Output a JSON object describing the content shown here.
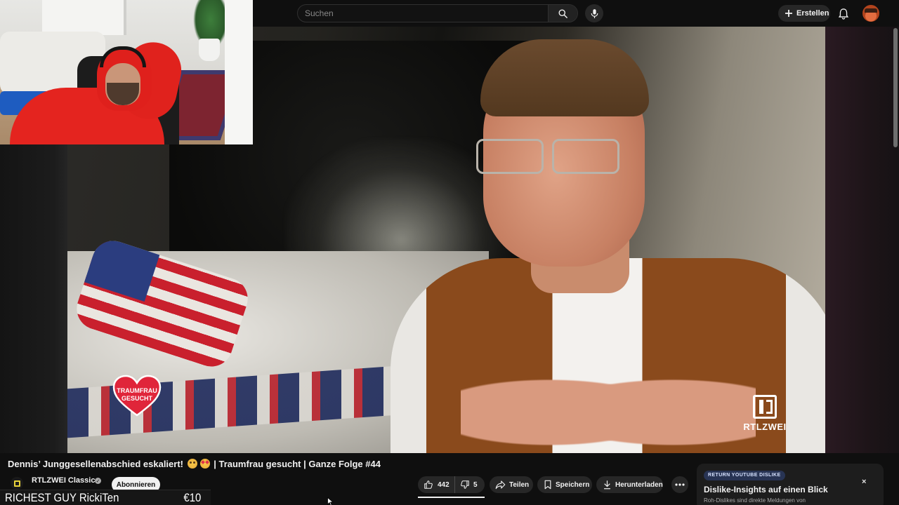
{
  "header": {
    "search": {
      "placeholder": "Suchen",
      "value": ""
    },
    "search_icon": "search-icon",
    "mic_icon": "mic-icon",
    "create_label": "Erstellen",
    "bell_icon": "bell-icon"
  },
  "video": {
    "logo_heart_line1": "TRAUMFRAU",
    "logo_heart_line2": "GESUCHT",
    "broadcaster_logo": "RTLZWEI"
  },
  "overlay": {
    "left_text": "RICHEST GUY RickiTen",
    "right_text": "€10"
  },
  "meta": {
    "title_part1": "Dennis’ Junggesellenabschied eskaliert!",
    "title_part2": "| Traumfrau gesucht | Ganze Folge #44",
    "channel_name": "RTLZWEI Classics",
    "subscribe_label": "Abonnieren"
  },
  "actions": {
    "like_count": "442",
    "dislike_count": "5",
    "share_label": "Teilen",
    "save_label": "Speichern",
    "download_label": "Herunterladen"
  },
  "return_dislike": {
    "badge": "RETURN YOUTUBE DISLIKE",
    "title": "Dislike-Insights auf einen Blick",
    "subtitle": "Roh-Dislikes sind direkte Meldungen von",
    "close": "×"
  },
  "colors": {
    "background": "#0f0f0f",
    "pill": "#272727",
    "subscribe_bg": "#f1f1f1",
    "heart": "#e0253a"
  }
}
